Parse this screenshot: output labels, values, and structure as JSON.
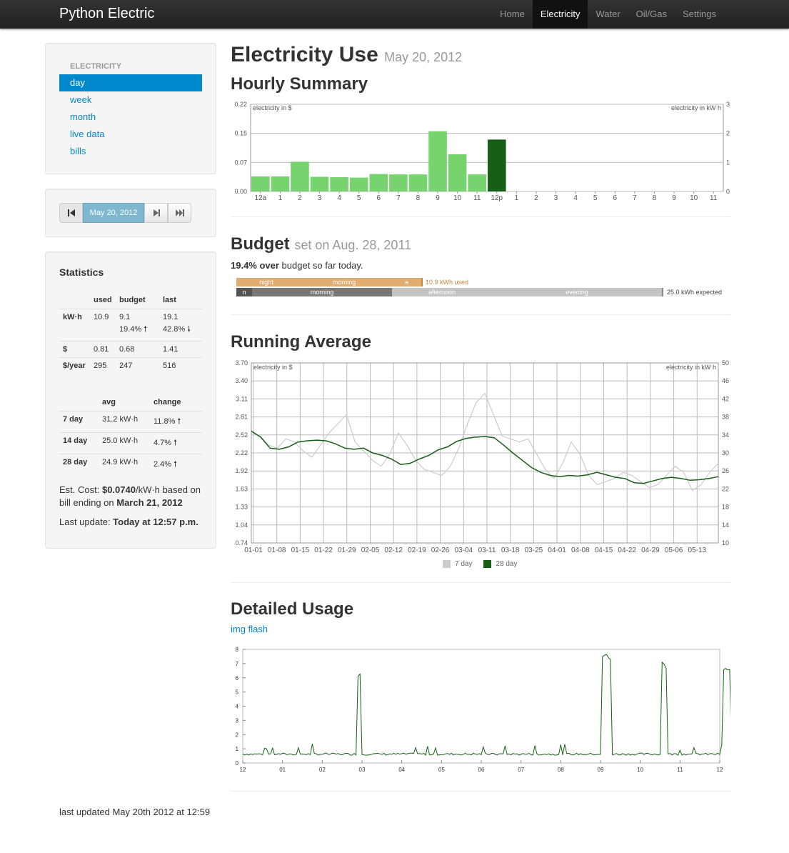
{
  "navbar": {
    "brand": "Python Electric",
    "items": [
      {
        "label": "Home",
        "active": false
      },
      {
        "label": "Electricity",
        "active": true
      },
      {
        "label": "Water",
        "active": false
      },
      {
        "label": "Oil/Gas",
        "active": false
      },
      {
        "label": "Settings",
        "active": false
      }
    ]
  },
  "sidebar": {
    "header": "ELECTRICITY",
    "items": [
      "day",
      "week",
      "month",
      "live data",
      "bills"
    ],
    "active_index": 0,
    "date_button": "May 20, 2012",
    "icons": [
      "skip-first-icon",
      "step-next-icon",
      "skip-last-icon"
    ]
  },
  "stats": {
    "title": "Statistics",
    "headers": [
      "",
      "used",
      "budget",
      "last"
    ],
    "kwh": {
      "label": "kW·h",
      "used": "10.9",
      "budget": "9.1",
      "budget_pct": "19.4%",
      "last": "19.1",
      "last_pct": "42.8%"
    },
    "dollar": {
      "label": "$",
      "used": "0.81",
      "budget": "0.68",
      "last": "1.41"
    },
    "year": {
      "label": "$/year",
      "used": "295",
      "budget": "247",
      "last": "516"
    },
    "avg_headers": [
      "",
      "avg",
      "change"
    ],
    "avg_rows": [
      {
        "label": "7 day",
        "avg": "31.2 kW·h",
        "change": "11.8%"
      },
      {
        "label": "14 day",
        "avg": "25.0 kW·h",
        "change": "4.7%"
      },
      {
        "label": "28 day",
        "avg": "24.9 kW·h",
        "change": "2.4%"
      }
    ],
    "est_prefix": "Est. Cost: ",
    "est_dollar": "$",
    "est_value": "0.0740",
    "est_mid": "/kW·h based on bill ending on ",
    "est_date": "March 21, 2012",
    "update_label": "Last update: ",
    "update_value": "Today at 12:57 p.m."
  },
  "page": {
    "title": "Electricity Use",
    "date": "May 20, 2012",
    "hourly_title": "Hourly Summary",
    "budget_title": "Budget",
    "budget_set": "set on Aug. 28, 2011",
    "budget_pct": "19.4% over",
    "budget_text": " budget so far today.",
    "running_title": "Running Average",
    "detailed_title": "Detailed Usage",
    "detailed_link_img": "img",
    "detailed_link_flash": "flash",
    "footer": "last updated May 20th 2012 at 12:59"
  },
  "budget_bars": {
    "actual": [
      {
        "label": "night",
        "color": "#e0ad6f"
      },
      {
        "label": "morning",
        "color": "#e0ad6f"
      },
      {
        "label": "a",
        "color": "#e0ad6f"
      }
    ],
    "actual_note": "10.9 kWh used",
    "expected": [
      {
        "label": "n",
        "color": "#555555"
      },
      {
        "label": "morning",
        "color": "#777777"
      },
      {
        "label": "afternoon",
        "color": "#c4c4c4"
      },
      {
        "label": "evening",
        "color": "#c4c4c4"
      }
    ],
    "expected_note": "25.0 kWh expected"
  },
  "chart_data": [
    {
      "id": "hourly",
      "type": "bar",
      "ylabel": "electricity in $",
      "y2label": "electricity in kW h",
      "ylim": [
        0,
        0.22
      ],
      "y_ticks": [
        "0.00",
        "0.07",
        "0.15",
        "0.22"
      ],
      "y2_ticks": [
        "0",
        "1",
        "2",
        "3"
      ],
      "categories": [
        "12a",
        "1",
        "2",
        "3",
        "4",
        "5",
        "6",
        "7",
        "8",
        "9",
        "10",
        "11",
        "12p",
        "1",
        "2",
        "3",
        "4",
        "5",
        "6",
        "7",
        "8",
        "9",
        "10",
        "11"
      ],
      "values": [
        0.038,
        0.038,
        0.075,
        0.037,
        0.036,
        0.035,
        0.044,
        0.043,
        0.043,
        0.152,
        0.094,
        0.043,
        0.131,
        0,
        0,
        0,
        0,
        0,
        0,
        0,
        0,
        0,
        0,
        0
      ],
      "current_index": 12,
      "colors": {
        "normal": "#77d36e",
        "current": "#175f16"
      }
    },
    {
      "id": "running",
      "type": "line",
      "ylabel": "electricity in $",
      "y2label": "electricity in kW h",
      "ylim": [
        0.74,
        3.7
      ],
      "y_ticks": [
        "0.74",
        "1.04",
        "1.33",
        "1.63",
        "1.92",
        "2.22",
        "2.52",
        "2.81",
        "3.11",
        "3.40",
        "3.70"
      ],
      "y2_ticks": [
        "10",
        "14",
        "18",
        "22",
        "26",
        "30",
        "34",
        "38",
        "42",
        "46",
        "50"
      ],
      "x_ticks": [
        "01-01",
        "01-08",
        "01-15",
        "01-22",
        "01-29",
        "02-05",
        "02-12",
        "02-19",
        "02-26",
        "03-04",
        "03-11",
        "03-18",
        "03-25",
        "04-01",
        "04-08",
        "04-15",
        "04-22",
        "04-29",
        "05-06",
        "05-13"
      ],
      "series": [
        {
          "name": "7 day",
          "color": "#cccccc",
          "values": [
            2.55,
            2.5,
            2.35,
            2.3,
            2.45,
            2.4,
            2.25,
            2.15,
            2.35,
            2.55,
            2.7,
            2.85,
            2.4,
            2.25,
            2.1,
            2.0,
            2.2,
            2.55,
            2.35,
            2.1,
            1.95,
            1.9,
            1.85,
            2.0,
            2.3,
            2.7,
            3.05,
            3.2,
            2.85,
            2.5,
            2.45,
            2.4,
            2.45,
            2.2,
            1.95,
            1.8,
            2.05,
            2.4,
            2.2,
            1.85,
            1.7,
            1.75,
            1.8,
            1.9,
            1.85,
            1.75,
            1.65,
            1.7,
            1.85,
            2.0,
            1.9,
            1.6,
            1.7,
            1.9,
            2.05
          ]
        },
        {
          "name": "28 day",
          "color": "#175f16",
          "values": [
            2.58,
            2.48,
            2.3,
            2.28,
            2.32,
            2.4,
            2.42,
            2.43,
            2.42,
            2.37,
            2.3,
            2.28,
            2.3,
            2.22,
            2.18,
            2.12,
            2.03,
            2.05,
            2.12,
            2.18,
            2.27,
            2.32,
            2.41,
            2.46,
            2.48,
            2.49,
            2.47,
            2.35,
            2.22,
            2.1,
            1.98,
            1.9,
            1.85,
            1.83,
            1.85,
            1.84,
            1.86,
            1.9,
            1.86,
            1.82,
            1.8,
            1.73,
            1.72,
            1.76,
            1.8,
            1.82,
            1.8,
            1.77,
            1.78,
            1.8,
            1.83
          ]
        }
      ]
    },
    {
      "id": "detailed",
      "type": "line",
      "ylim": [
        0,
        8
      ],
      "y_ticks": [
        "0",
        "1",
        "2",
        "3",
        "4",
        "5",
        "6",
        "7",
        "8"
      ],
      "x_ticks": [
        "12",
        "01",
        "02",
        "03",
        "04",
        "05",
        "06",
        "07",
        "08",
        "09",
        "10",
        "11",
        "12"
      ],
      "color": "#175f16",
      "spikes": [
        {
          "at": 2.85,
          "width": 0.1,
          "level": 6.4
        },
        {
          "at": 9.0,
          "width": 0.25,
          "level": 7.8
        },
        {
          "at": 10.55,
          "width": 0.15,
          "level": 7.1
        },
        {
          "at": 12.1,
          "width": 0.2,
          "level": 7.0
        }
      ]
    }
  ]
}
